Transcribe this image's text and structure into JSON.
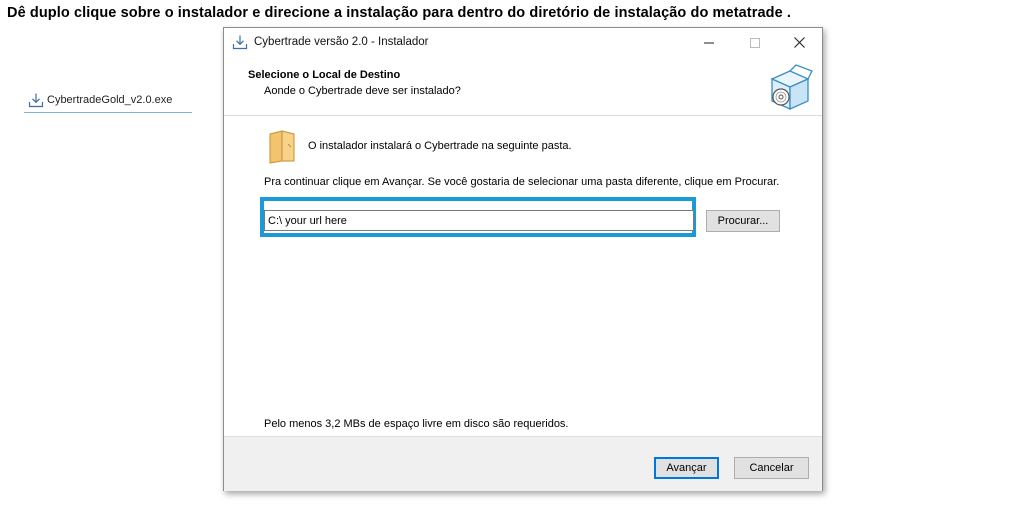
{
  "headline": "Dê duplo clique sobre o instalador e direcione a instalação para dentro do diretório de instalação do metatrade .",
  "desktop_file": {
    "name": "CybertradeGold_v2.0.exe",
    "icon": "installer-download-icon"
  },
  "window": {
    "title": "Cybertrade versão 2.0 - Instalador",
    "icon": "installer-download-icon",
    "controls": {
      "minimize": "—",
      "maximize": "☐",
      "close": "✕"
    }
  },
  "header": {
    "title": "Selecione o Local de Destino",
    "subtitle": "Aonde o Cybertrade deve ser instalado?",
    "icon": "software-box-cd-icon"
  },
  "content": {
    "folder_icon": "folder-icon",
    "install_text": "O instalador instalará o Cybertrade na seguinte pasta.",
    "continue_text": "Pra continuar clique em Avançar. Se você gostaria de selecionar uma pasta diferente, clique em Procurar.",
    "path_value": "C:\\ your url here",
    "browse_label": "Procurar...",
    "disk_space_text": "Pelo menos 3,2 MBs de espaço livre em disco são requeridos."
  },
  "footer": {
    "next_label": "Avançar",
    "cancel_label": "Cancelar"
  },
  "colors": {
    "highlight": "#1a9ad8",
    "folder": "#f4c36d",
    "primary_border": "#0078d7"
  }
}
